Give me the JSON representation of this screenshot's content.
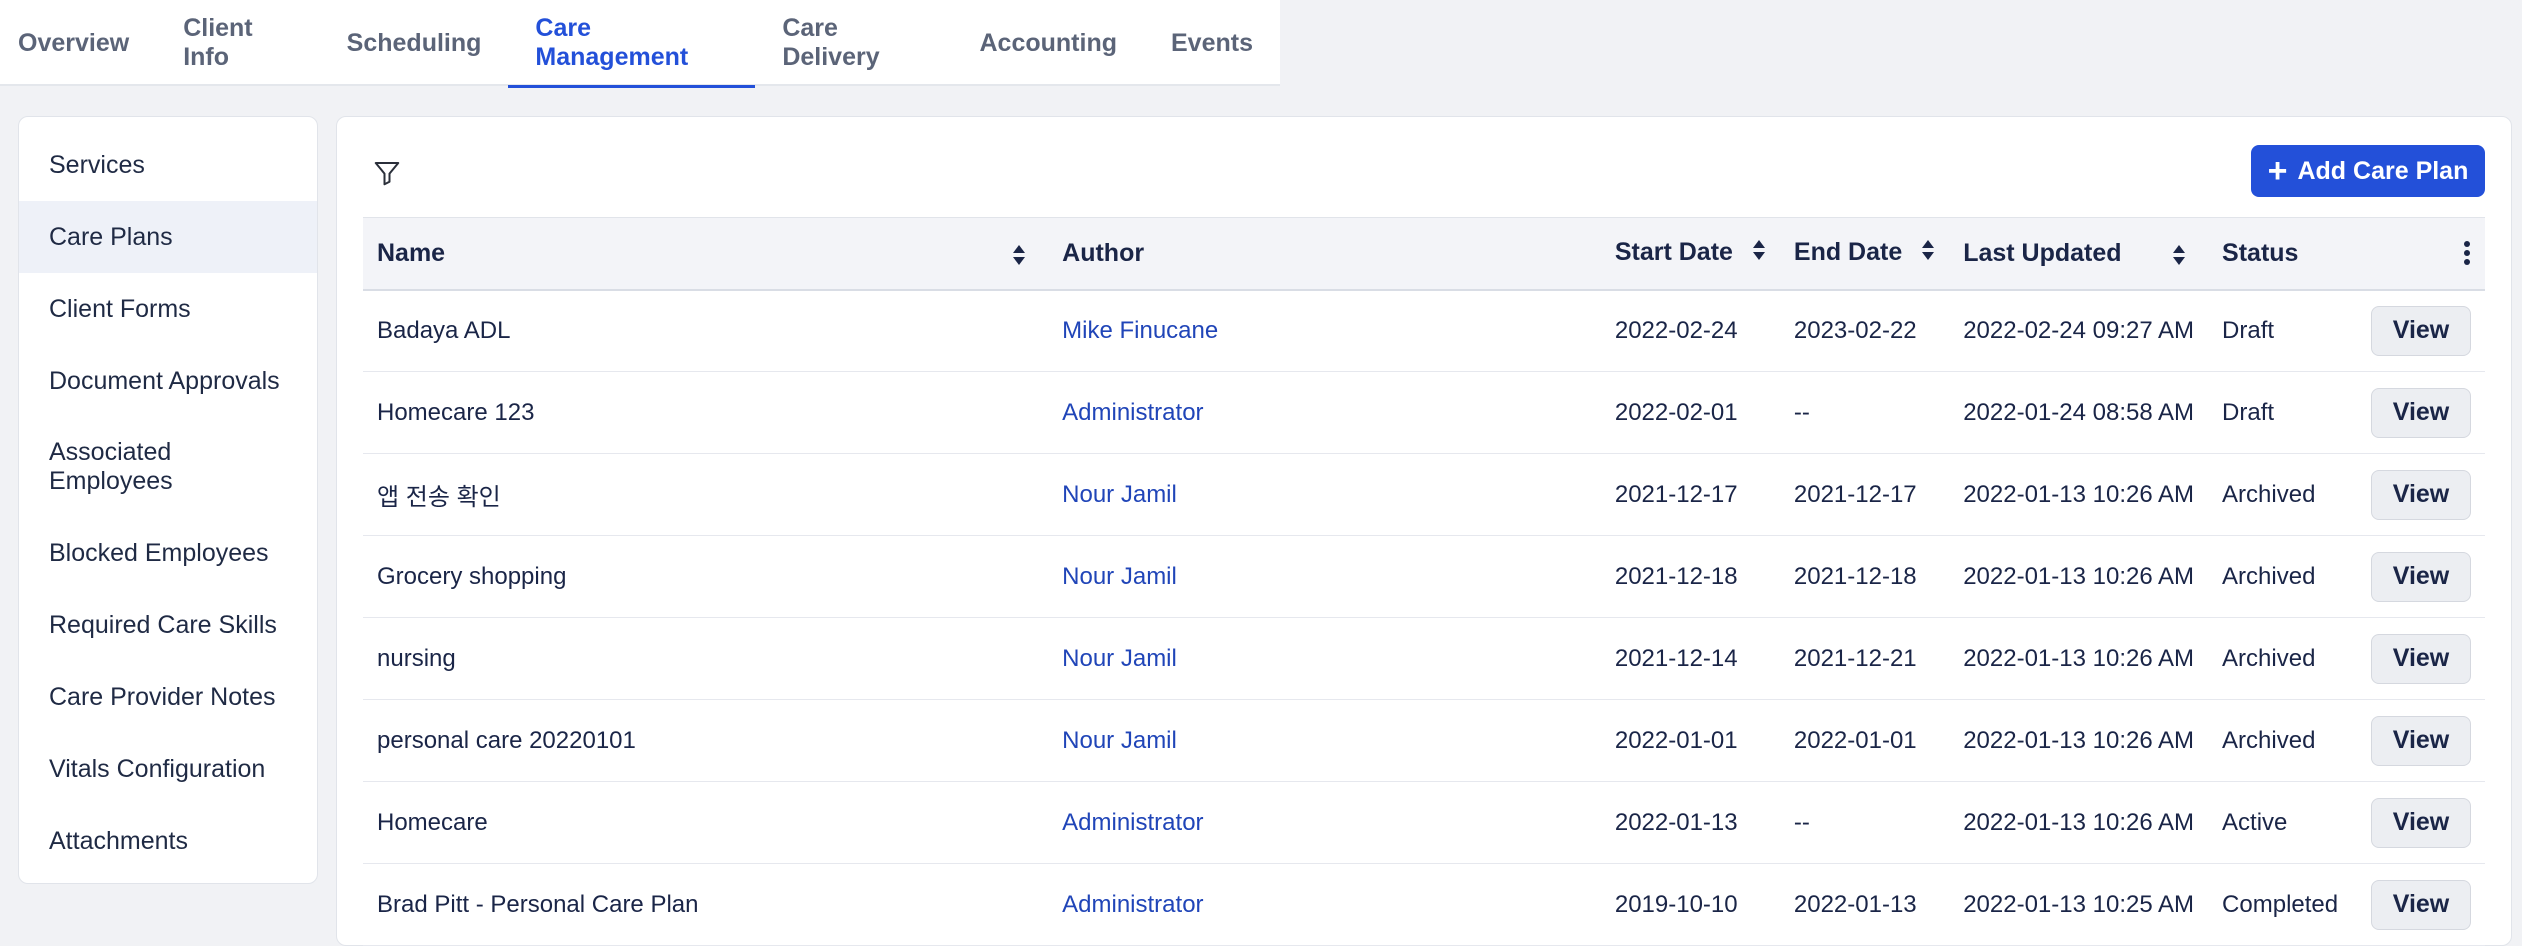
{
  "tabs": [
    {
      "label": "Overview"
    },
    {
      "label": "Client Info"
    },
    {
      "label": "Scheduling"
    },
    {
      "label": "Care Management",
      "active": true
    },
    {
      "label": "Care Delivery"
    },
    {
      "label": "Accounting"
    },
    {
      "label": "Events"
    }
  ],
  "sidebar": {
    "items": [
      {
        "label": "Services"
      },
      {
        "label": "Care Plans",
        "active": true
      },
      {
        "label": "Client Forms"
      },
      {
        "label": "Document Approvals"
      },
      {
        "label": "Associated Employees"
      },
      {
        "label": "Blocked Employees"
      },
      {
        "label": "Required Care Skills"
      },
      {
        "label": "Care Provider Notes"
      },
      {
        "label": "Vitals Configuration"
      },
      {
        "label": "Attachments"
      }
    ]
  },
  "toolbar": {
    "filter_icon": "filter-icon",
    "add_label": "Add Care Plan"
  },
  "table": {
    "headers": {
      "name": "Name",
      "author": "Author",
      "start_date": "Start Date",
      "end_date": "End Date",
      "last_updated": "Last Updated",
      "status": "Status"
    },
    "view_label": "View",
    "rows": [
      {
        "name": "Badaya ADL",
        "author": "Mike Finucane",
        "start": "2022-02-24",
        "end": "2023-02-22",
        "updated": "2022-02-24 09:27 AM",
        "status": "Draft"
      },
      {
        "name": "Homecare 123",
        "author": "Administrator",
        "start": "2022-02-01",
        "end": "--",
        "updated": "2022-01-24 08:58 AM",
        "status": "Draft"
      },
      {
        "name": "앱 전송 확인",
        "author": "Nour Jamil",
        "start": "2021-12-17",
        "end": "2021-12-17",
        "updated": "2022-01-13 10:26 AM",
        "status": "Archived"
      },
      {
        "name": "Grocery shopping",
        "author": "Nour Jamil",
        "start": "2021-12-18",
        "end": "2021-12-18",
        "updated": "2022-01-13 10:26 AM",
        "status": "Archived"
      },
      {
        "name": "nursing",
        "author": "Nour Jamil",
        "start": "2021-12-14",
        "end": "2021-12-21",
        "updated": "2022-01-13 10:26 AM",
        "status": "Archived"
      },
      {
        "name": "personal care 20220101",
        "author": "Nour Jamil",
        "start": "2022-01-01",
        "end": "2022-01-01",
        "updated": "2022-01-13 10:26 AM",
        "status": "Archived"
      },
      {
        "name": "Homecare",
        "author": "Administrator",
        "start": "2022-01-13",
        "end": "--",
        "updated": "2022-01-13 10:26 AM",
        "status": "Active"
      },
      {
        "name": "Brad Pitt - Personal Care Plan",
        "author": "Administrator",
        "start": "2019-10-10",
        "end": "2022-01-13",
        "updated": "2022-01-13 10:25 AM",
        "status": "Completed"
      }
    ]
  },
  "colors": {
    "accent": "#2350d9",
    "link": "#2045b8",
    "text": "#1a2547"
  }
}
